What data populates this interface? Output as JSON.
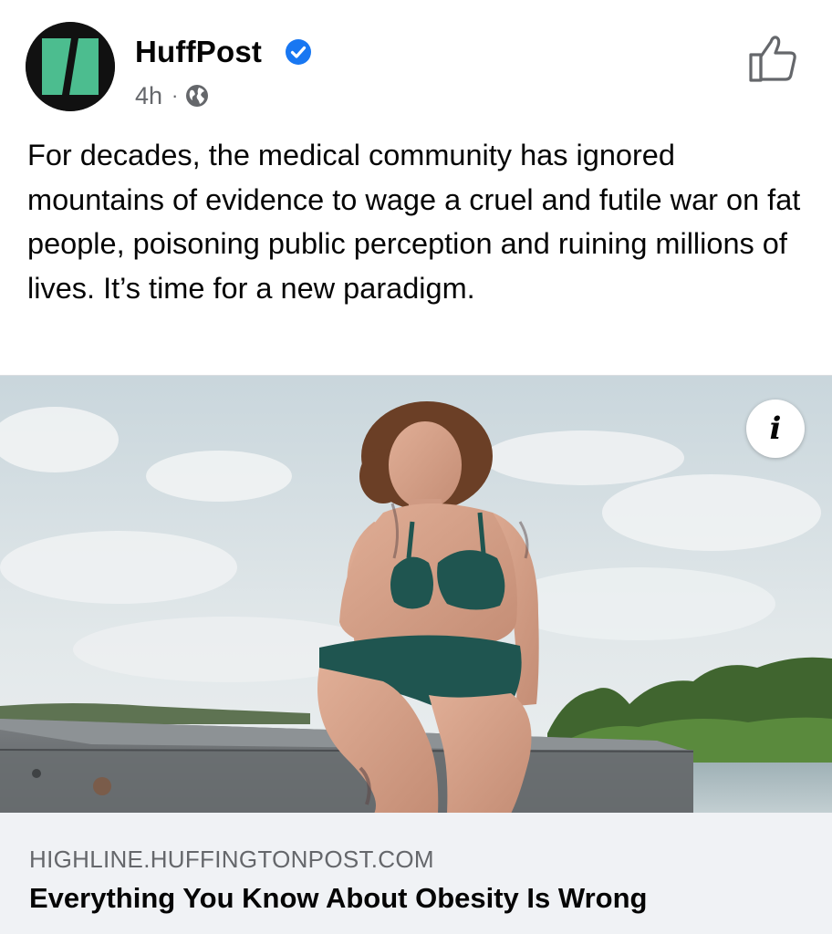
{
  "header": {
    "page_name": "HuffPost",
    "time": "4h",
    "separator": "·",
    "audience_icon": "globe-icon",
    "verified_icon": "verified-badge-icon",
    "like_icon": "thumbs-up-icon"
  },
  "post": {
    "text": "For decades, the medical community has ignored mountains of evidence to wage a cruel and futile war on fat people, poisoning public perception and ruining millions of lives. It’s time for a new paradigm."
  },
  "link_preview": {
    "info_label": "i",
    "domain": "HIGHLINE.HUFFINGTONPOST.COM",
    "title": "Everything You Know About Obesity Is Wrong"
  },
  "colors": {
    "brand_green": "#4cbd8f",
    "verified_blue": "#1877f2",
    "secondary_text": "#65676b",
    "footer_bg": "#f0f2f5"
  }
}
